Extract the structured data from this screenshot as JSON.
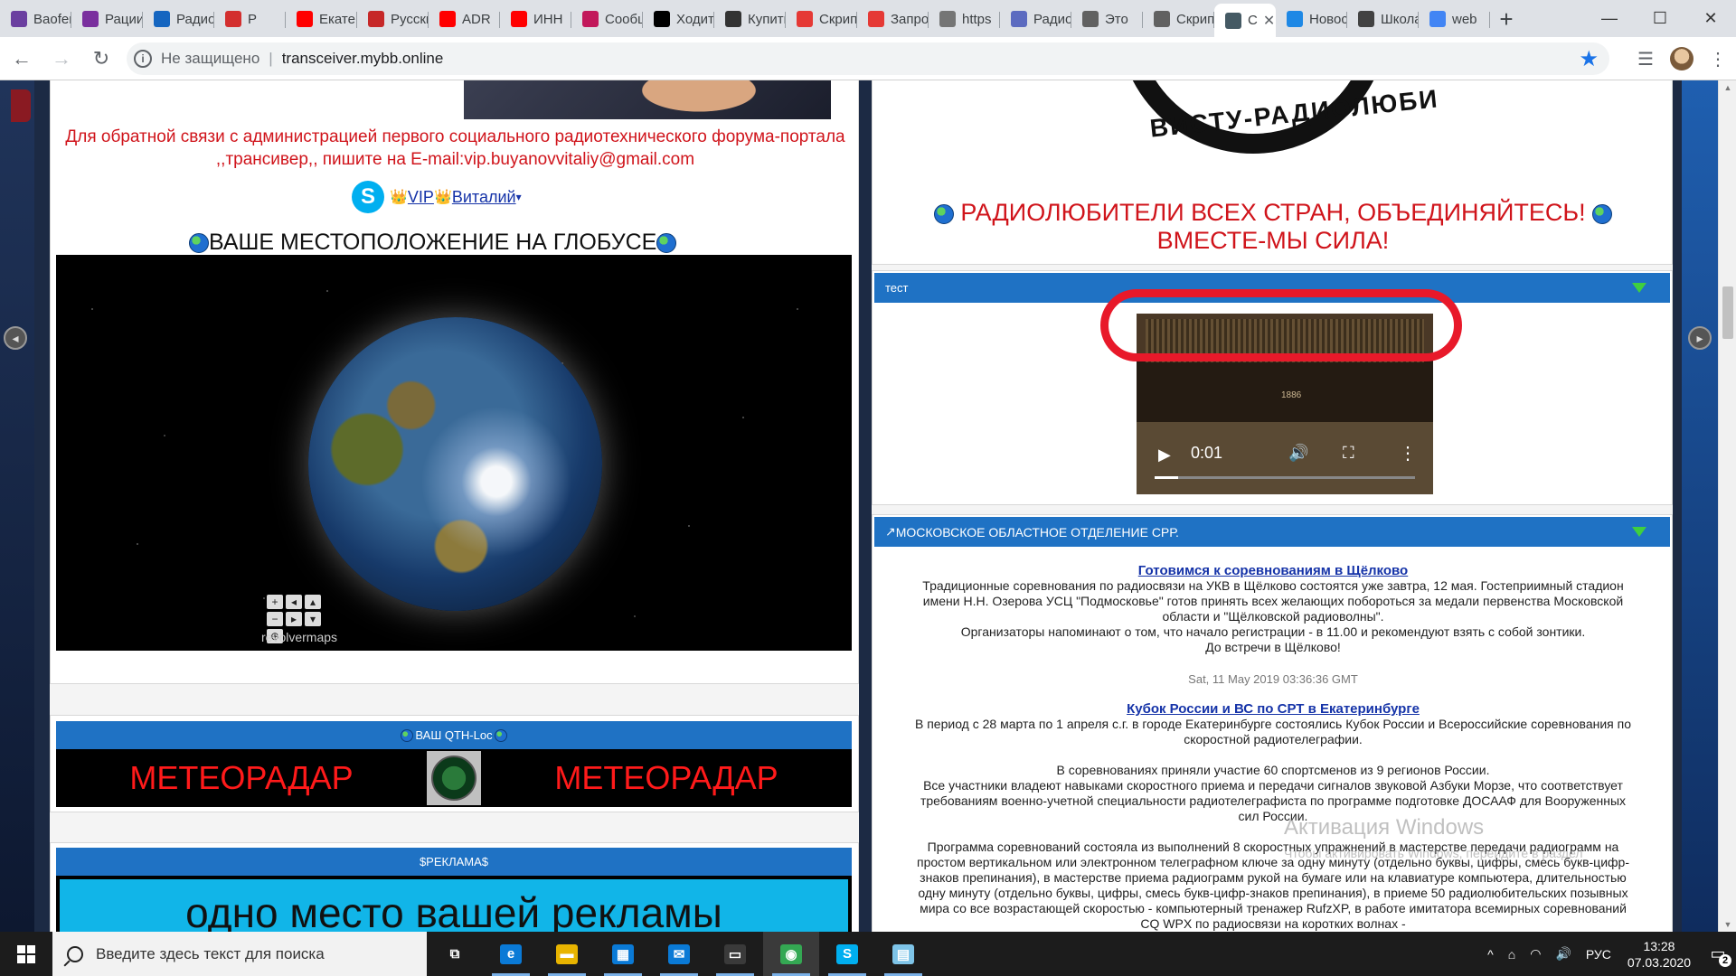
{
  "tabs": [
    {
      "label": "Baofeng",
      "icon": "square-purple-icon",
      "color": "#6b3fa0"
    },
    {
      "label": "Рации",
      "icon": "square-purple-icon",
      "color": "#7a2f9e"
    },
    {
      "label": "Радио",
      "icon": "pulse-icon",
      "color": "#1565c0"
    },
    {
      "label": "Р",
      "icon": "phone-red-icon",
      "color": "#d32f2f"
    },
    {
      "label": "Екатеринбург",
      "icon": "youtube-icon",
      "color": "#ff0000"
    },
    {
      "label": "Русский",
      "icon": "pdf-icon",
      "color": "#c62828"
    },
    {
      "label": "ADR",
      "icon": "youtube-icon",
      "color": "#ff0000"
    },
    {
      "label": "ИНН",
      "icon": "youtube-icon",
      "color": "#ff0000"
    },
    {
      "label": "Сообщение",
      "icon": "mail-red-icon",
      "color": "#c2185b"
    },
    {
      "label": "Ходить",
      "icon": "sh-icon",
      "color": "#000000"
    },
    {
      "label": "Купить",
      "icon": "radio-icon",
      "color": "#333333"
    },
    {
      "label": "Скрипт",
      "icon": "badge-14-icon",
      "color": "#e53935"
    },
    {
      "label": "Запрос",
      "icon": "badge-14-icon",
      "color": "#e53935"
    },
    {
      "label": "https",
      "icon": "globe-gray-icon",
      "color": "#757575"
    },
    {
      "label": "Радио",
      "icon": "diamond-blue-icon",
      "color": "#5c6bc0"
    },
    {
      "label": "Это",
      "icon": "globe-gray-icon",
      "color": "#616161"
    },
    {
      "label": "Скрипт",
      "icon": "globe-gray-icon",
      "color": "#616161"
    },
    {
      "label": "С",
      "icon": "page-icon",
      "color": "#455a64",
      "active": true
    },
    {
      "label": "Новости",
      "icon": "bird-icon",
      "color": "#1e88e5"
    },
    {
      "label": "Школа",
      "icon": "puzzle-icon",
      "color": "#424242"
    },
    {
      "label": "web",
      "icon": "google-icon",
      "color": "#4285f4"
    }
  ],
  "tab_close_glyph": "✕",
  "new_tab_glyph": "+",
  "window_controls": {
    "minimize": "—",
    "maximize": "☐",
    "close": "✕"
  },
  "nav": {
    "back": "←",
    "forward": "→",
    "reload": "↻"
  },
  "omnibox": {
    "security_label": "Не защищено",
    "url": "transceiver.mybb.online",
    "bookmark_star": "★"
  },
  "toolbar_icons": {
    "reading_list": "☰",
    "menu": "⋮"
  },
  "left": {
    "feedback_text": "Для обратной связи с администрацией первого социального радиотехнического форума-портала ,,трансивер,, пишите на E-mail:vip.buyanovvitaliy@gmail.com",
    "skype_letter": "S",
    "vip_crown_left": "👑",
    "vip_label": "VIP",
    "vip_crown_right": "👑",
    "vip_name": "Виталий",
    "vip_caret": "▾",
    "globe_heading": "ВАШЕ МЕСТОПОЛОЖЕНИЕ НА ГЛОБУСЕ",
    "globe_controls": [
      "+",
      "◂",
      "▴",
      "−",
      "▸",
      "▾",
      "⊕"
    ],
    "globe_brand": "revolvermaps",
    "qth_title": "ВАШ QTH-Loc",
    "meteo_left": "МЕТЕОРАДАР",
    "meteo_right": "МЕТЕОРАДАР",
    "ad_title": "$РЕКЛАМА$",
    "ad_text": "одно место вашей рекламы"
  },
  "right": {
    "logo_text": "ВИСТУ-РАДИОЛЮБИ",
    "slogan_line1": "РАДИОЛЮБИТЕЛИ ВСЕХ СТРАН, ОБЪЕДИНЯЙТЕСЬ!",
    "slogan_line2": "ВМЕСТЕ-МЫ СИЛА!",
    "test_title": "тест",
    "video": {
      "play": "▶",
      "time": "0:01",
      "volume": "🔊",
      "fullscreen": "⛶",
      "menu": "⋮",
      "progress": 0.09,
      "brand": "1886"
    },
    "mo_title": "МОСКОВСКОЕ ОБЛАСТНОЕ ОТДЕЛЕНИЕ СРР.",
    "mo_title_prefix": "↗",
    "news": [
      {
        "title": "Готовимся к соревнованиям в Щёлково",
        "body": [
          "Традиционные соревнования по радиосвязи на УКВ в Щёлково состоятся уже завтра, 12 мая. Гостеприимный стадион имени Н.Н. Озерова УСЦ \"Подмосковье\" готов принять всех желающих побороться за медали первенства Московской области и \"Щёлковской радиоволны\".",
          "Организаторы напоминают о том, что начало регистрации - в 11.00 и рекомендуют взять с собой зонтики.",
          "До встречи в Щёлково!"
        ],
        "date": "Sat, 11 May 2019 03:36:36 GMT"
      },
      {
        "title": "Кубок России и ВС по СРТ в Екатеринбурге",
        "body": [
          "В период с 28 марта по 1 апреля с.г. в городе Екатеринбурге состоялись Кубок России и Всероссийские соревнования по скоростной радиотелеграфии.",
          "",
          "В соревнованиях приняли участие 60 спортсменов из 9 регионов России.",
          "Все участники владеют навыками скоростного приема и передачи сигналов звуковой Азбуки Морзе, что соответствует требованиям военно-учетной специальности радиотелеграфиста по программе подготовке ДОСААФ для Вооруженных сил России.",
          "",
          "Программа соревнований состояла из выполнений 8 скоростных упражнений в мастерстве передачи радиограмм на простом вертикальном или электронном телеграфном ключе за одну минуту (отдельно буквы, цифры, смесь букв-цифр-знаков препинания), в мастерстве приема радиограмм рукой на бумаге или на клавиатуре компьютера, длительностью одну минуту (отдельно буквы, цифры, смесь букв-цифр-знаков препинания), в приеме 50 радиолюбительских позывных мира со все возрастающей скоростью - компьютерный тренажер RufzXP, в работе имитатора всемирных соревнований CQ WPX по радиосвязи на коротких волнах -"
        ]
      }
    ]
  },
  "activation": {
    "title": "Активация Windows",
    "subtitle": "Чтобы активировать Windows, перейдите в раздел"
  },
  "taskbar": {
    "search_placeholder": "Введите здесь текст для поиска",
    "apps": [
      {
        "name": "task-view",
        "glyph": "⧉",
        "color": "#1c1c1c"
      },
      {
        "name": "edge",
        "glyph": "e",
        "color": "#0a7ad6"
      },
      {
        "name": "explorer",
        "glyph": "▬",
        "color": "#e8b400"
      },
      {
        "name": "store",
        "glyph": "▦",
        "color": "#0a7ad6"
      },
      {
        "name": "mail",
        "glyph": "✉",
        "color": "#0a7ad6"
      },
      {
        "name": "terminal",
        "glyph": "▭",
        "color": "#3a3a3a"
      },
      {
        "name": "chrome",
        "glyph": "◉",
        "color": "#34a853",
        "current": true
      },
      {
        "name": "skype",
        "glyph": "S",
        "color": "#00aff0"
      },
      {
        "name": "notepad",
        "glyph": "▤",
        "color": "#7ec4e8"
      }
    ],
    "tray": {
      "chevron": "^",
      "network": "⌂",
      "wifi": "◠",
      "volume": "🔊",
      "lang": "РУС"
    },
    "time": "13:28",
    "date": "07.03.2020",
    "notifications": "2"
  }
}
